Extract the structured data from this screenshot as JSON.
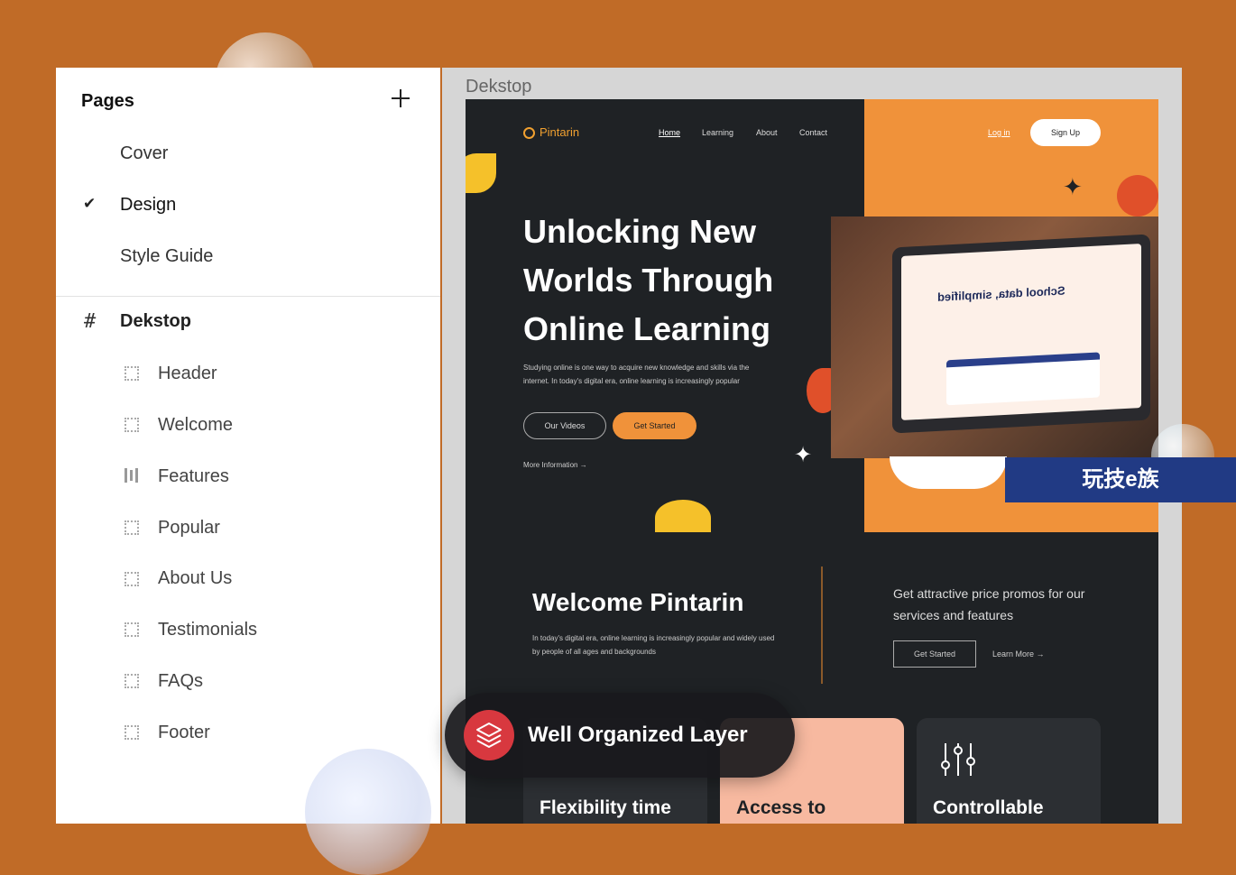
{
  "pages_panel": {
    "title": "Pages",
    "items": [
      {
        "label": "Cover",
        "selected": false
      },
      {
        "label": "Design",
        "selected": true
      },
      {
        "label": "Style Guide",
        "selected": false
      }
    ]
  },
  "layers_panel": {
    "frame_label": "Dekstop",
    "layers": [
      {
        "label": "Header",
        "icon": "frame-icon"
      },
      {
        "label": "Welcome",
        "icon": "frame-icon"
      },
      {
        "label": "Features",
        "icon": "columns-icon"
      },
      {
        "label": "Popular",
        "icon": "frame-icon"
      },
      {
        "label": "About Us",
        "icon": "frame-icon"
      },
      {
        "label": "Testimonials",
        "icon": "frame-icon"
      },
      {
        "label": "FAQs",
        "icon": "frame-icon"
      },
      {
        "label": "Footer",
        "icon": "frame-icon"
      }
    ]
  },
  "canvas": {
    "frame_label": "Dekstop"
  },
  "site": {
    "logo": "Pintarin",
    "nav": [
      "Home",
      "Learning",
      "About",
      "Contact"
    ],
    "login": "Log in",
    "signup": "Sign Up",
    "hero_title": "Unlocking New Worlds Through Online Learning",
    "hero_desc": "Studying online is one way to acquire new knowledge and skills via the internet. In today's digital era, online learning is increasingly popular",
    "btn_videos": "Our Videos",
    "btn_started": "Get Started",
    "more_info": "More Information",
    "laptop_title": "School data, simplified",
    "welcome_title": "Welcome Pintarin",
    "welcome_desc": "In today's digital era, online learning is increasingly popular and widely used by people of all ages and backgrounds",
    "promo": "Get attractive price promos for our services and features",
    "promo_btn": "Get Started",
    "learn_more": "Learn More",
    "cards": [
      "Flexibility time",
      "Access to",
      "Controllable"
    ]
  },
  "badge": {
    "label": "Well Organized Layer",
    "icon": "layers-icon"
  },
  "watermark": "玩技e族",
  "colors": {
    "background": "#c06b27",
    "accent": "#f0923a",
    "dark": "#1f2225",
    "badge_red": "#d8383f"
  }
}
